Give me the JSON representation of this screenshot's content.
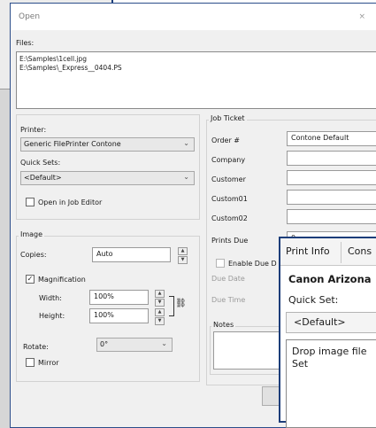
{
  "dialog": {
    "title": "Open",
    "close_glyph": "×",
    "files_label": "Files:",
    "files": [
      "E:\\Samples\\1cell.jpg",
      "E:\\Samples\\_Express__0404.PS"
    ]
  },
  "printer": {
    "label": "Printer:",
    "value": "Generic FilePrinter Contone",
    "quick_sets_label": "Quick Sets:",
    "quick_sets_value": "<Default>",
    "open_in_editor_label": "Open in Job Editor",
    "open_in_editor_checked": false
  },
  "image": {
    "group_title": "Image",
    "copies_label": "Copies:",
    "copies_value": "Auto",
    "magnification_label": "Magnification",
    "magnification_checked": true,
    "width_label": "Width:",
    "width_value": "100%",
    "height_label": "Height:",
    "height_value": "100%",
    "rotate_label": "Rotate:",
    "rotate_value": "0°",
    "mirror_label": "Mirror",
    "mirror_checked": false
  },
  "job_ticket": {
    "group_title": "Job Ticket",
    "fields": [
      {
        "label": "Order #",
        "value": "Contone Default"
      },
      {
        "label": "Company",
        "value": ""
      },
      {
        "label": "Customer",
        "value": ""
      },
      {
        "label": "Custom01",
        "value": ""
      },
      {
        "label": "Custom02",
        "value": ""
      },
      {
        "label": "Prints Due",
        "value": "0"
      }
    ],
    "enable_due_label": "Enable Due D",
    "due_date_label": "Due Date",
    "due_time_label": "Due Time",
    "notes_label": "Notes"
  },
  "panel": {
    "tabs": [
      "Print Info",
      "Cons"
    ],
    "printer_name": "Canon Arizona",
    "quick_set_label": "Quick Set:",
    "quick_set_value": "<Default>",
    "drop_text_1": "Drop image file",
    "drop_text_2": "Set"
  },
  "colors": {
    "accent_border": "#1d3e7a",
    "dialog_bg": "#f0f0f0"
  }
}
